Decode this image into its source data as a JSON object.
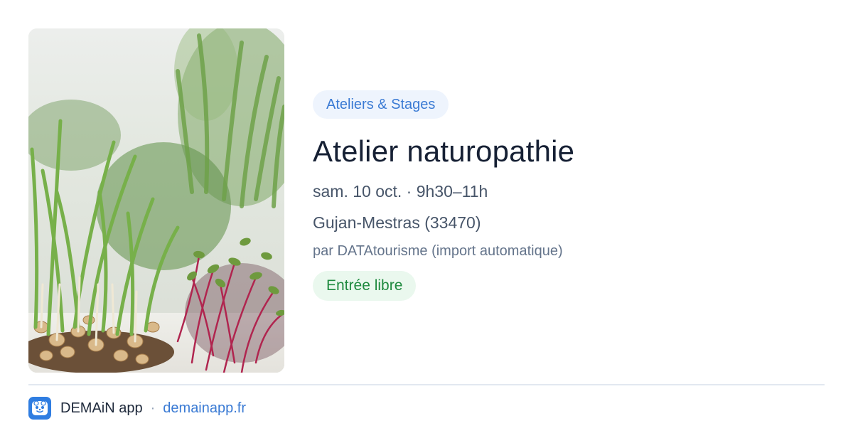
{
  "event": {
    "category": "Ateliers & Stages",
    "title": "Atelier naturopathie",
    "datetime": "sam. 10 oct. · 9h30–11h",
    "location": "Gujan-Mestras (33470)",
    "organizer": "par DATAtourisme (import automatique)",
    "price": "Entrée libre",
    "image_icon": "microgreens-photo"
  },
  "footer": {
    "app_name": "DEMAiN app",
    "separator": "·",
    "link": "demainapp.fr",
    "logo_icon": "demain-app-logo"
  },
  "colors": {
    "category_chip_bg": "#eef4fd",
    "category_chip_text": "#3b7bd4",
    "price_chip_bg": "#eaf8ee",
    "price_chip_text": "#1f8a3f",
    "title_text": "#162034",
    "link": "#3b7bd4",
    "logo_bg": "#2f7de1"
  }
}
